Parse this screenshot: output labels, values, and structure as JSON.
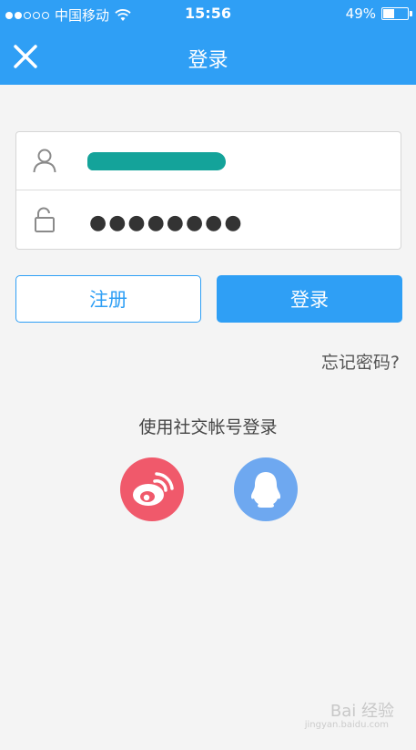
{
  "status_bar": {
    "carrier": "中国移动",
    "time": "15:56",
    "battery_text": "49%",
    "battery_level": 0.49
  },
  "nav": {
    "close_icon": "close-icon",
    "title": "登录"
  },
  "form": {
    "username": {
      "icon": "user-icon",
      "value": ""
    },
    "password": {
      "icon": "unlock-icon",
      "masked_value": "●●●●●●●●"
    }
  },
  "buttons": {
    "register_label": "注册",
    "login_label": "登录"
  },
  "forgot_password": "忘记密码?",
  "social": {
    "title": "使用社交帐号登录",
    "providers": [
      {
        "name": "weibo",
        "icon": "weibo-icon",
        "color": "#f0596b"
      },
      {
        "name": "qq",
        "icon": "qq-icon",
        "color": "#6ea8f0"
      }
    ]
  },
  "watermark": {
    "text": "Bai 经验",
    "sub": "jingyan.baidu.com"
  },
  "colors": {
    "primary": "#2f9ff5",
    "background": "#f4f4f4"
  }
}
